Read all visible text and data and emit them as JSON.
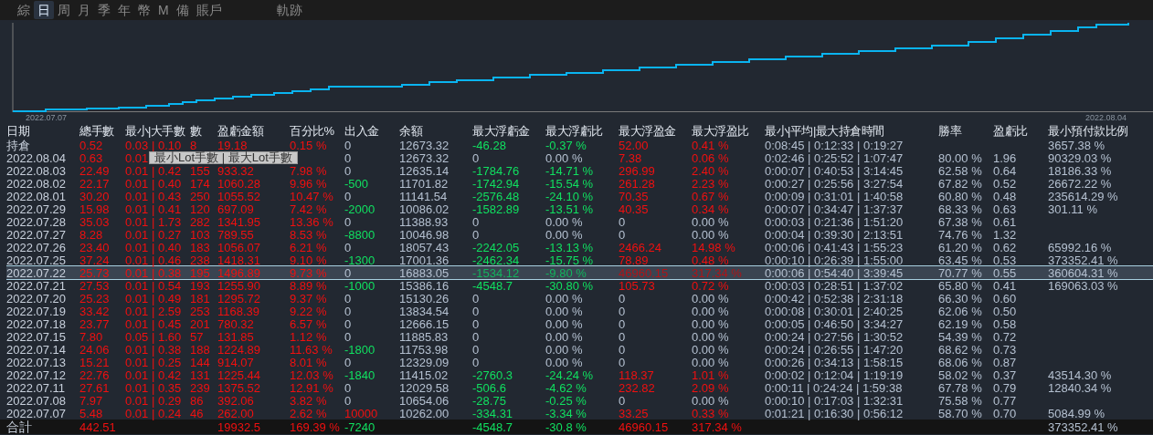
{
  "tabs": [
    {
      "label": "綜",
      "selected": false
    },
    {
      "label": "日",
      "selected": true
    },
    {
      "label": "周",
      "selected": false
    },
    {
      "label": "月",
      "selected": false
    },
    {
      "label": "季",
      "selected": false
    },
    {
      "label": "年",
      "selected": false
    },
    {
      "label": "幣",
      "selected": false
    },
    {
      "label": "M",
      "selected": false
    },
    {
      "label": "備",
      "selected": false
    },
    {
      "label": "賬戶",
      "selected": false
    }
  ],
  "trace_tab": {
    "label": "軌跡",
    "selected": false
  },
  "chart": {
    "start_label": "2022.07.07",
    "end_label": "2022.08.04"
  },
  "table": {
    "columns": [
      "日期",
      "總手數",
      "最小|大手數",
      "數",
      "盈虧金額",
      "百分比%",
      "出入金",
      "余額",
      "最大浮虧金",
      "最大浮虧比",
      "最大浮盈金",
      "最大浮盈比",
      "最小|平均|最大持倉時間",
      "勝率",
      "盈虧比",
      "最小預付款比例"
    ],
    "rows": [
      {
        "date": "持倉",
        "selected": false,
        "total_lots": "0.52",
        "min_max_lots": "0.03 | 0.10",
        "count": "8",
        "profit": "19.18",
        "percent": "0.15 %",
        "deposit": {
          "text": "0",
          "color": "#b4c0d0"
        },
        "balance": "12673.32",
        "max_float_loss": {
          "text": "-46.28",
          "color": "#10e060"
        },
        "max_float_loss_pct": {
          "text": "-0.37 %",
          "color": "#10e060"
        },
        "max_float_profit": {
          "text": "52.00",
          "color": "#f01010"
        },
        "max_float_profit_pct": {
          "text": "0.41 %",
          "color": "#f01010"
        },
        "hold_times": "0:08:45 | 0:12:33 | 0:19:27",
        "min_margin_ratio": "3657.38 %"
      },
      {
        "date": "2022.08.04",
        "selected": false,
        "total_lots": "0.63",
        "min_max_lots": "0.01",
        "deposit": {
          "text": "0",
          "color": "#b4c0d0"
        },
        "balance": "12673.32",
        "max_float_loss": {
          "text": "0",
          "color": "#b4c0d0"
        },
        "max_float_loss_pct": {
          "text": "0.00 %",
          "color": "#b4c0d0"
        },
        "max_float_profit": {
          "text": "7.38",
          "color": "#f01010"
        },
        "max_float_profit_pct": {
          "text": "0.06 %",
          "color": "#f01010"
        },
        "hold_times": "0:02:46 | 0:25:52 | 1:07:47",
        "win_rate": "80.00 %",
        "profit_factor": "1.96",
        "min_margin_ratio": "90329.03 %"
      },
      {
        "date": "2022.08.03",
        "selected": false,
        "total_lots": "22.49",
        "min_max_lots": "0.01 | 0.42",
        "count": "155",
        "profit": "933.32",
        "percent": "7.98 %",
        "deposit": {
          "text": "0",
          "color": "#b4c0d0"
        },
        "balance": "12635.14",
        "max_float_loss": {
          "text": "-1784.76",
          "color": "#10e060"
        },
        "max_float_loss_pct": {
          "text": "-14.71 %",
          "color": "#10e060"
        },
        "max_float_profit": {
          "text": "296.99",
          "color": "#f01010"
        },
        "max_float_profit_pct": {
          "text": "2.40 %",
          "color": "#f01010"
        },
        "hold_times": "0:00:07 | 0:40:53 | 3:14:45",
        "win_rate": "62.58 %",
        "profit_factor": "0.64",
        "min_margin_ratio": "18186.33 %"
      },
      {
        "date": "2022.08.02",
        "selected": false,
        "total_lots": "22.17",
        "min_max_lots": "0.01 | 0.40",
        "count": "174",
        "profit": "1060.28",
        "percent": "9.96 %",
        "deposit": {
          "text": "-500",
          "color": "#10e060"
        },
        "balance": "11701.82",
        "max_float_loss": {
          "text": "-1742.94",
          "color": "#10e060"
        },
        "max_float_loss_pct": {
          "text": "-15.54 %",
          "color": "#10e060"
        },
        "max_float_profit": {
          "text": "261.28",
          "color": "#f01010"
        },
        "max_float_profit_pct": {
          "text": "2.23 %",
          "color": "#f01010"
        },
        "hold_times": "0:00:27 | 0:25:56 | 3:27:54",
        "win_rate": "67.82 %",
        "profit_factor": "0.52",
        "min_margin_ratio": "26672.22 %"
      },
      {
        "date": "2022.08.01",
        "selected": false,
        "total_lots": "30.20",
        "min_max_lots": "0.01 | 0.43",
        "count": "250",
        "profit": "1055.52",
        "percent": "10.47 %",
        "deposit": {
          "text": "0",
          "color": "#b4c0d0"
        },
        "balance": "11141.54",
        "max_float_loss": {
          "text": "-2576.48",
          "color": "#10e060"
        },
        "max_float_loss_pct": {
          "text": "-24.10 %",
          "color": "#10e060"
        },
        "max_float_profit": {
          "text": "70.35",
          "color": "#f01010"
        },
        "max_float_profit_pct": {
          "text": "0.67 %",
          "color": "#f01010"
        },
        "hold_times": "0:00:09 | 0:31:01 | 1:40:58",
        "win_rate": "60.80 %",
        "profit_factor": "0.48",
        "min_margin_ratio": "235614.29 %"
      },
      {
        "date": "2022.07.29",
        "selected": false,
        "total_lots": "15.98",
        "min_max_lots": "0.01 | 0.41",
        "count": "120",
        "profit": "697.09",
        "percent": "7.42 %",
        "deposit": {
          "text": "-2000",
          "color": "#10e060"
        },
        "balance": "10086.02",
        "max_float_loss": {
          "text": "-1582.89",
          "color": "#10e060"
        },
        "max_float_loss_pct": {
          "text": "-13.51 %",
          "color": "#10e060"
        },
        "max_float_profit": {
          "text": "40.35",
          "color": "#f01010"
        },
        "max_float_profit_pct": {
          "text": "0.34 %",
          "color": "#f01010"
        },
        "hold_times": "0:00:07 | 0:34:47 | 1:37:37",
        "win_rate": "68.33 %",
        "profit_factor": "0.63",
        "min_margin_ratio": "301.11 %"
      },
      {
        "date": "2022.07.28",
        "selected": false,
        "total_lots": "35.03",
        "min_max_lots": "0.01 | 1.73",
        "count": "282",
        "profit": "1341.95",
        "percent": "13.36 %",
        "deposit": {
          "text": "0",
          "color": "#b4c0d0"
        },
        "balance": "11388.93",
        "max_float_loss": {
          "text": "0",
          "color": "#b4c0d0"
        },
        "max_float_loss_pct": {
          "text": "0.00 %",
          "color": "#b4c0d0"
        },
        "max_float_profit": {
          "text": "0",
          "color": "#b4c0d0"
        },
        "max_float_profit_pct": {
          "text": "0.00 %",
          "color": "#b4c0d0"
        },
        "hold_times": "0:00:03 | 0:21:36 | 1:51:20",
        "win_rate": "67.38 %",
        "profit_factor": "0.61"
      },
      {
        "date": "2022.07.27",
        "selected": false,
        "total_lots": "8.28",
        "min_max_lots": "0.01 | 0.27",
        "count": "103",
        "profit": "789.55",
        "percent": "8.53 %",
        "deposit": {
          "text": "-8800",
          "color": "#10e060"
        },
        "balance": "10046.98",
        "max_float_loss": {
          "text": "0",
          "color": "#b4c0d0"
        },
        "max_float_loss_pct": {
          "text": "0.00 %",
          "color": "#b4c0d0"
        },
        "max_float_profit": {
          "text": "0",
          "color": "#b4c0d0"
        },
        "max_float_profit_pct": {
          "text": "0.00 %",
          "color": "#b4c0d0"
        },
        "hold_times": "0:00:04 | 0:39:30 | 2:13:51",
        "win_rate": "74.76 %",
        "profit_factor": "1.32"
      },
      {
        "date": "2022.07.26",
        "selected": false,
        "total_lots": "23.40",
        "min_max_lots": "0.01 | 0.40",
        "count": "183",
        "profit": "1056.07",
        "percent": "6.21 %",
        "deposit": {
          "text": "0",
          "color": "#b4c0d0"
        },
        "balance": "18057.43",
        "max_float_loss": {
          "text": "-2242.05",
          "color": "#10e060"
        },
        "max_float_loss_pct": {
          "text": "-13.13 %",
          "color": "#10e060"
        },
        "max_float_profit": {
          "text": "2466.24",
          "color": "#f01010"
        },
        "max_float_profit_pct": {
          "text": "14.98 %",
          "color": "#f01010"
        },
        "hold_times": "0:00:06 | 0:41:43 | 1:55:23",
        "win_rate": "61.20 %",
        "profit_factor": "0.62",
        "min_margin_ratio": "65992.16 %"
      },
      {
        "date": "2022.07.25",
        "selected": false,
        "total_lots": "37.24",
        "min_max_lots": "0.01 | 0.46",
        "count": "238",
        "profit": "1418.31",
        "percent": "9.10 %",
        "deposit": {
          "text": "-1300",
          "color": "#10e060"
        },
        "balance": "17001.36",
        "max_float_loss": {
          "text": "-2462.34",
          "color": "#10e060"
        },
        "max_float_loss_pct": {
          "text": "-15.75 %",
          "color": "#10e060"
        },
        "max_float_profit": {
          "text": "78.89",
          "color": "#f01010"
        },
        "max_float_profit_pct": {
          "text": "0.48 %",
          "color": "#f01010"
        },
        "hold_times": "0:00:10 | 0:26:39 | 1:55:00",
        "win_rate": "63.45 %",
        "profit_factor": "0.53",
        "min_margin_ratio": "373352.41 %"
      },
      {
        "date": "2022.07.22",
        "selected": true,
        "total_lots": "25.73",
        "min_max_lots": "0.01 | 0.38",
        "count": "195",
        "profit": "1496.89",
        "percent": "9.73 %",
        "deposit": {
          "text": "0",
          "color": "#b4c0d0"
        },
        "balance": "16883.05",
        "max_float_loss": {
          "text": "-1534.12",
          "color": "#12b45e"
        },
        "max_float_loss_pct": {
          "text": "-9.80 %",
          "color": "#12b45e"
        },
        "max_float_profit": {
          "text": "46960.15",
          "color": "#b01418"
        },
        "max_float_profit_pct": {
          "text": "317.34 %",
          "color": "#b01418"
        },
        "hold_times": "0:00:06 | 0:54:40 | 3:39:45",
        "win_rate": "70.77 %",
        "profit_factor": "0.55",
        "min_margin_ratio": "360604.31 %"
      },
      {
        "date": "2022.07.21",
        "selected": false,
        "total_lots": "27.53",
        "min_max_lots": "0.01 | 0.54",
        "count": "193",
        "profit": "1255.90",
        "percent": "8.89 %",
        "deposit": {
          "text": "-1000",
          "color": "#10e060"
        },
        "balance": "15386.16",
        "max_float_loss": {
          "text": "-4548.7",
          "color": "#10e060"
        },
        "max_float_loss_pct": {
          "text": "-30.80 %",
          "color": "#10e060"
        },
        "max_float_profit": {
          "text": "105.73",
          "color": "#f01010"
        },
        "max_float_profit_pct": {
          "text": "0.72 %",
          "color": "#f01010"
        },
        "hold_times": "0:00:03 | 0:28:51 | 1:37:02",
        "win_rate": "65.80 %",
        "profit_factor": "0.41",
        "min_margin_ratio": "169063.03 %"
      },
      {
        "date": "2022.07.20",
        "selected": false,
        "total_lots": "25.23",
        "min_max_lots": "0.01 | 0.49",
        "count": "181",
        "profit": "1295.72",
        "percent": "9.37 %",
        "deposit": {
          "text": "0",
          "color": "#b4c0d0"
        },
        "balance": "15130.26",
        "max_float_loss": {
          "text": "0",
          "color": "#b4c0d0"
        },
        "max_float_loss_pct": {
          "text": "0.00 %",
          "color": "#b4c0d0"
        },
        "max_float_profit": {
          "text": "0",
          "color": "#b4c0d0"
        },
        "max_float_profit_pct": {
          "text": "0.00 %",
          "color": "#b4c0d0"
        },
        "hold_times": "0:00:42 | 0:52:38 | 2:31:18",
        "win_rate": "66.30 %",
        "profit_factor": "0.60"
      },
      {
        "date": "2022.07.19",
        "selected": false,
        "total_lots": "33.42",
        "min_max_lots": "0.01 | 2.59",
        "count": "253",
        "profit": "1168.39",
        "percent": "9.22 %",
        "deposit": {
          "text": "0",
          "color": "#b4c0d0"
        },
        "balance": "13834.54",
        "max_float_loss": {
          "text": "0",
          "color": "#b4c0d0"
        },
        "max_float_loss_pct": {
          "text": "0.00 %",
          "color": "#b4c0d0"
        },
        "max_float_profit": {
          "text": "0",
          "color": "#b4c0d0"
        },
        "max_float_profit_pct": {
          "text": "0.00 %",
          "color": "#b4c0d0"
        },
        "hold_times": "0:00:08 | 0:30:01 | 2:40:25",
        "win_rate": "62.06 %",
        "profit_factor": "0.50"
      },
      {
        "date": "2022.07.18",
        "selected": false,
        "total_lots": "23.77",
        "min_max_lots": "0.01 | 0.45",
        "count": "201",
        "profit": "780.32",
        "percent": "6.57 %",
        "deposit": {
          "text": "0",
          "color": "#b4c0d0"
        },
        "balance": "12666.15",
        "max_float_loss": {
          "text": "0",
          "color": "#b4c0d0"
        },
        "max_float_loss_pct": {
          "text": "0.00 %",
          "color": "#b4c0d0"
        },
        "max_float_profit": {
          "text": "0",
          "color": "#b4c0d0"
        },
        "max_float_profit_pct": {
          "text": "0.00 %",
          "color": "#b4c0d0"
        },
        "hold_times": "0:00:05 | 0:46:50 | 3:34:27",
        "win_rate": "62.19 %",
        "profit_factor": "0.58"
      },
      {
        "date": "2022.07.15",
        "selected": false,
        "total_lots": "7.80",
        "min_max_lots": "0.05 | 1.60",
        "count": "57",
        "profit": "131.85",
        "percent": "1.12 %",
        "deposit": {
          "text": "0",
          "color": "#b4c0d0"
        },
        "balance": "11885.83",
        "max_float_loss": {
          "text": "0",
          "color": "#b4c0d0"
        },
        "max_float_loss_pct": {
          "text": "0.00 %",
          "color": "#b4c0d0"
        },
        "max_float_profit": {
          "text": "0",
          "color": "#b4c0d0"
        },
        "max_float_profit_pct": {
          "text": "0.00 %",
          "color": "#b4c0d0"
        },
        "hold_times": "0:00:24 | 0:27:56 | 1:30:52",
        "win_rate": "54.39 %",
        "profit_factor": "0.72"
      },
      {
        "date": "2022.07.14",
        "selected": false,
        "total_lots": "24.06",
        "min_max_lots": "0.01 | 0.38",
        "count": "188",
        "profit": "1224.89",
        "percent": "11.63 %",
        "deposit": {
          "text": "-1800",
          "color": "#10e060"
        },
        "balance": "11753.98",
        "max_float_loss": {
          "text": "0",
          "color": "#b4c0d0"
        },
        "max_float_loss_pct": {
          "text": "0.00 %",
          "color": "#b4c0d0"
        },
        "max_float_profit": {
          "text": "0",
          "color": "#b4c0d0"
        },
        "max_float_profit_pct": {
          "text": "0.00 %",
          "color": "#b4c0d0"
        },
        "hold_times": "0:00:24 | 0:26:55 | 1:47:20",
        "win_rate": "68.62 %",
        "profit_factor": "0.73"
      },
      {
        "date": "2022.07.13",
        "selected": false,
        "total_lots": "15.21",
        "min_max_lots": "0.01 | 0.25",
        "count": "144",
        "profit": "914.07",
        "percent": "8.01 %",
        "deposit": {
          "text": "0",
          "color": "#b4c0d0"
        },
        "balance": "12329.09",
        "max_float_loss": {
          "text": "0",
          "color": "#b4c0d0"
        },
        "max_float_loss_pct": {
          "text": "0.00 %",
          "color": "#b4c0d0"
        },
        "max_float_profit": {
          "text": "0",
          "color": "#b4c0d0"
        },
        "max_float_profit_pct": {
          "text": "0.00 %",
          "color": "#b4c0d0"
        },
        "hold_times": "0:00:26 | 0:34:13 | 1:58:15",
        "win_rate": "68.06 %",
        "profit_factor": "0.87"
      },
      {
        "date": "2022.07.12",
        "selected": false,
        "total_lots": "22.76",
        "min_max_lots": "0.01 | 0.42",
        "count": "131",
        "profit": "1225.44",
        "percent": "12.03 %",
        "deposit": {
          "text": "-1840",
          "color": "#10e060"
        },
        "balance": "11415.02",
        "max_float_loss": {
          "text": "-2760.3",
          "color": "#10e060"
        },
        "max_float_loss_pct": {
          "text": "-24.24 %",
          "color": "#10e060"
        },
        "max_float_profit": {
          "text": "118.37",
          "color": "#f01010"
        },
        "max_float_profit_pct": {
          "text": "1.01 %",
          "color": "#f01010"
        },
        "hold_times": "0:00:02 | 0:12:04 | 1:19:19",
        "win_rate": "58.02 %",
        "profit_factor": "0.37",
        "min_margin_ratio": "43514.30 %"
      },
      {
        "date": "2022.07.11",
        "selected": false,
        "total_lots": "27.61",
        "min_max_lots": "0.01 | 0.35",
        "count": "239",
        "profit": "1375.52",
        "percent": "12.91 %",
        "deposit": {
          "text": "0",
          "color": "#b4c0d0"
        },
        "balance": "12029.58",
        "max_float_loss": {
          "text": "-506.6",
          "color": "#10e060"
        },
        "max_float_loss_pct": {
          "text": "-4.62 %",
          "color": "#10e060"
        },
        "max_float_profit": {
          "text": "232.82",
          "color": "#f01010"
        },
        "max_float_profit_pct": {
          "text": "2.09 %",
          "color": "#f01010"
        },
        "hold_times": "0:00:11 | 0:24:24 | 1:59:38",
        "win_rate": "67.78 %",
        "profit_factor": "0.79",
        "min_margin_ratio": "12840.34 %"
      },
      {
        "date": "2022.07.08",
        "selected": false,
        "total_lots": "7.97",
        "min_max_lots": "0.01 | 0.29",
        "count": "86",
        "profit": "392.06",
        "percent": "3.82 %",
        "deposit": {
          "text": "0",
          "color": "#b4c0d0"
        },
        "balance": "10654.06",
        "max_float_loss": {
          "text": "-28.75",
          "color": "#10e060"
        },
        "max_float_loss_pct": {
          "text": "-0.25 %",
          "color": "#10e060"
        },
        "max_float_profit": {
          "text": "0",
          "color": "#b4c0d0"
        },
        "max_float_profit_pct": {
          "text": "0.00 %",
          "color": "#b4c0d0"
        },
        "hold_times": "0:00:10 | 0:17:03 | 1:32:31",
        "win_rate": "75.58 %",
        "profit_factor": "0.77"
      },
      {
        "date": "2022.07.07",
        "selected": false,
        "total_lots": "5.48",
        "min_max_lots": "0.01 | 0.24",
        "count": "46",
        "profit": "262.00",
        "percent": "2.62 %",
        "deposit": {
          "text": "10000",
          "color": "#f01010"
        },
        "balance": "10262.00",
        "max_float_loss": {
          "text": "-334.31",
          "color": "#10e060"
        },
        "max_float_loss_pct": {
          "text": "-3.34 %",
          "color": "#10e060"
        },
        "max_float_profit": {
          "text": "33.25",
          "color": "#f01010"
        },
        "max_float_profit_pct": {
          "text": "0.33 %",
          "color": "#f01010"
        },
        "hold_times": "0:01:21 | 0:16:30 | 0:56:12",
        "win_rate": "58.70 %",
        "profit_factor": "0.70",
        "min_margin_ratio": "5084.99 %"
      }
    ],
    "total": {
      "label": "合計",
      "total_lots": "442.51",
      "profit": "19932.5",
      "percent": "169.39 %",
      "deposit": {
        "text": "-7240",
        "color": "#10e060"
      },
      "max_float_loss": {
        "text": "-4548.7",
        "color": "#10e060"
      },
      "max_float_loss_pct": {
        "text": "-30.8 %",
        "color": "#10e060"
      },
      "max_float_profit": {
        "text": "46960.15",
        "color": "#f01010"
      },
      "max_float_profit_pct": {
        "text": "317.34 %",
        "color": "#f01010"
      },
      "min_margin_ratio": "373352.41 %"
    }
  },
  "tooltip": {
    "text": "最小Lot手數 | 最大Lot手數"
  }
}
